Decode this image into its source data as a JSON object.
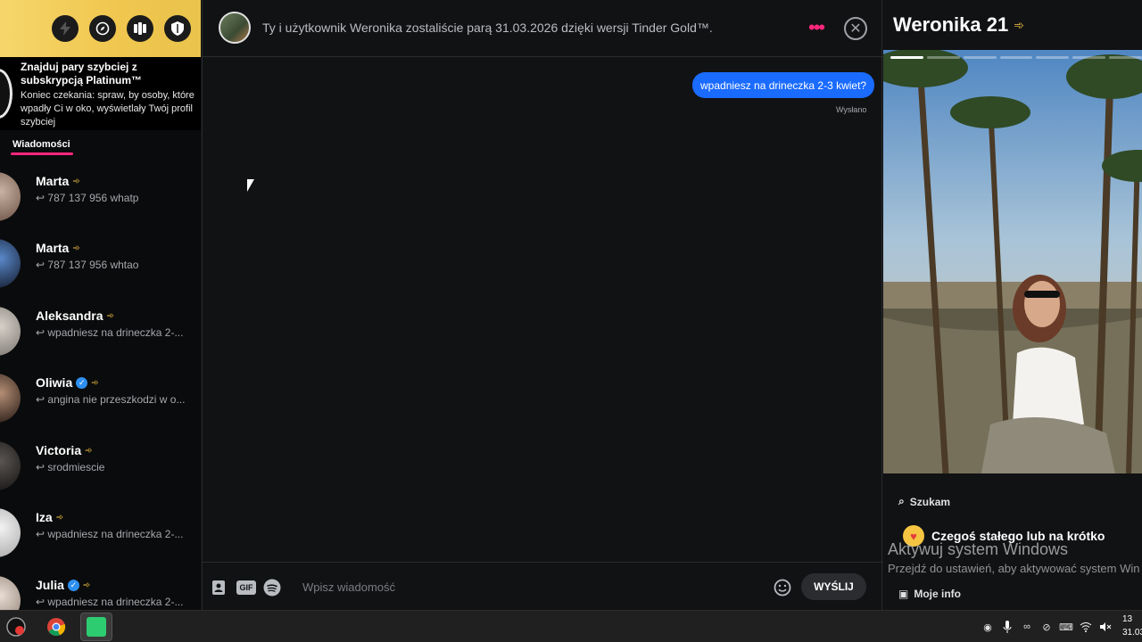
{
  "sidebar": {
    "promo_title": "Znajduj pary szybciej z subskrypcją Platinum™",
    "promo_sub": "Koniec czekania: spraw, by osoby, które wpadły Ci w oko, wyświetlały Twój profil szybciej",
    "tab_messages": "Wiadomości",
    "conversations": [
      {
        "name": "Marta",
        "preview": "787 137 956 whatp",
        "verified": false
      },
      {
        "name": "Marta",
        "preview": "787 137 956 whtao",
        "verified": false
      },
      {
        "name": "Aleksandra",
        "preview": "wpadniesz na drineczka 2-...",
        "verified": false
      },
      {
        "name": "Oliwia",
        "preview": "angina nie przeszkodzi w o...",
        "verified": true
      },
      {
        "name": "Victoria",
        "preview": "srodmiescie",
        "verified": false
      },
      {
        "name": "Iza",
        "preview": "wpadniesz na drineczka 2-...",
        "verified": false
      },
      {
        "name": "Julia",
        "preview": "wpadniesz na drineczka 2-...",
        "verified": true
      }
    ]
  },
  "chat": {
    "header_text": "Ty i użytkownik Weronika zostaliście parą 31.03.2026 dzięki wersji Tinder Gold™.",
    "messages": [
      {
        "text": "wpadniesz na drineczka 2-3 kwiet?",
        "status": "Wysłano"
      }
    ],
    "composer": {
      "placeholder": "Wpisz wiadomość",
      "send_label": "WYŚLIJ",
      "gif_label": "GIF"
    }
  },
  "profile": {
    "name_age": "Weronika 21",
    "section_looking": "Szukam",
    "looking_for": "Czegoś stałego lub na krótko",
    "section_info": "Moje info"
  },
  "system": {
    "watermark_title": "Aktywuj system Windows",
    "watermark_sub": "Przejdź do ustawień, aby aktywować system Win",
    "clock_time": "13",
    "clock_date": "31.03"
  },
  "colors": {
    "accent": "#fd267d",
    "bubble": "#1a6bff",
    "gold": "#f5c542"
  }
}
